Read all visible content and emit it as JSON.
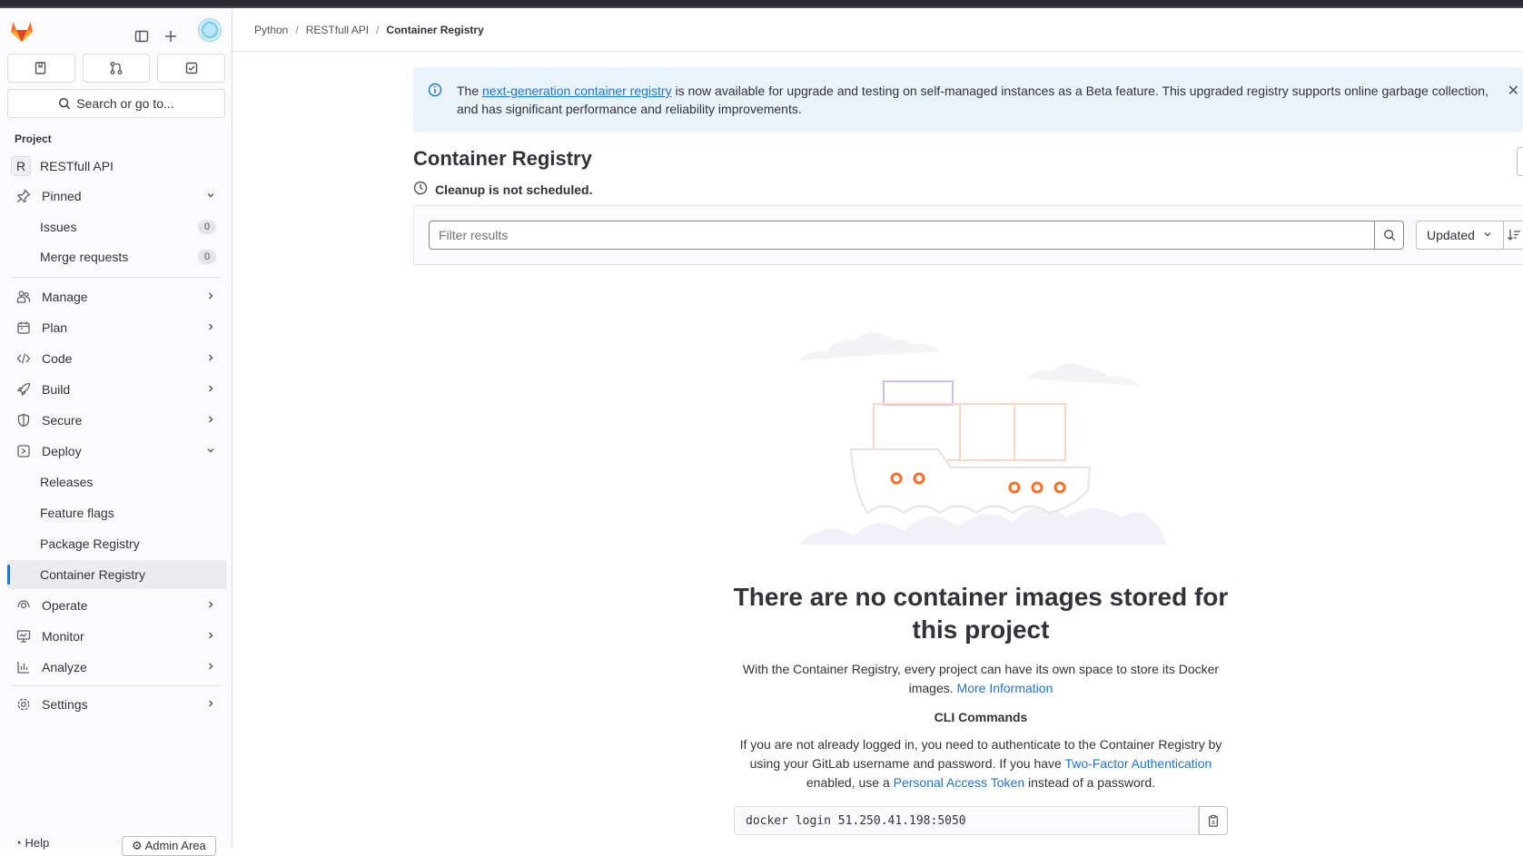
{
  "breadcrumb": [
    "Python",
    "RESTfull API",
    "Container Registry"
  ],
  "sidebar": {
    "search_label": "Search or go to...",
    "section_title": "Project",
    "project_letter": "R",
    "project_name": "RESTfull API",
    "pinned": "Pinned",
    "pinned_items": [
      {
        "label": "Issues",
        "count": "0"
      },
      {
        "label": "Merge requests",
        "count": "0"
      }
    ],
    "groups": [
      "Manage",
      "Plan",
      "Code",
      "Build",
      "Secure",
      "Deploy"
    ],
    "deploy_items": [
      "Releases",
      "Feature flags",
      "Package Registry",
      "Container Registry"
    ],
    "groups2": [
      "Operate",
      "Monitor",
      "Analyze"
    ],
    "settings": "Settings",
    "help": "Help",
    "admin": "Admin Area"
  },
  "alert": {
    "prefix": "The ",
    "link": "next-generation container registry",
    "suffix": " is now available for upgrade and testing on self-managed instances as a Beta feature. This upgraded registry supports online garbage collection, and has significant performance and reliability improvements."
  },
  "page": {
    "title": "Container Registry",
    "cleanup": "Cleanup is not scheduled."
  },
  "filter": {
    "placeholder": "Filter results",
    "sort_label": "Updated"
  },
  "empty": {
    "title": "There are no container images stored for this project",
    "desc": "With the Container Registry, every project can have its own space to store its Docker images.",
    "more_link": "More Information",
    "cli_title": "CLI Commands",
    "cli_1": "If you are not already logged in, you need to authenticate to the Container Registry by using your GitLab username and password. If you have ",
    "cli_link1": "Two-Factor Authentication",
    "cli_2": " enabled, use a ",
    "cli_link2": "Personal Access Token",
    "cli_3": " instead of a password.",
    "command": "docker login 51.250.41.198:5050"
  },
  "colors": {
    "accent": "#1f75cb",
    "alert_bg": "#e9f3fc",
    "illustration_orange": "#fc6d26"
  }
}
